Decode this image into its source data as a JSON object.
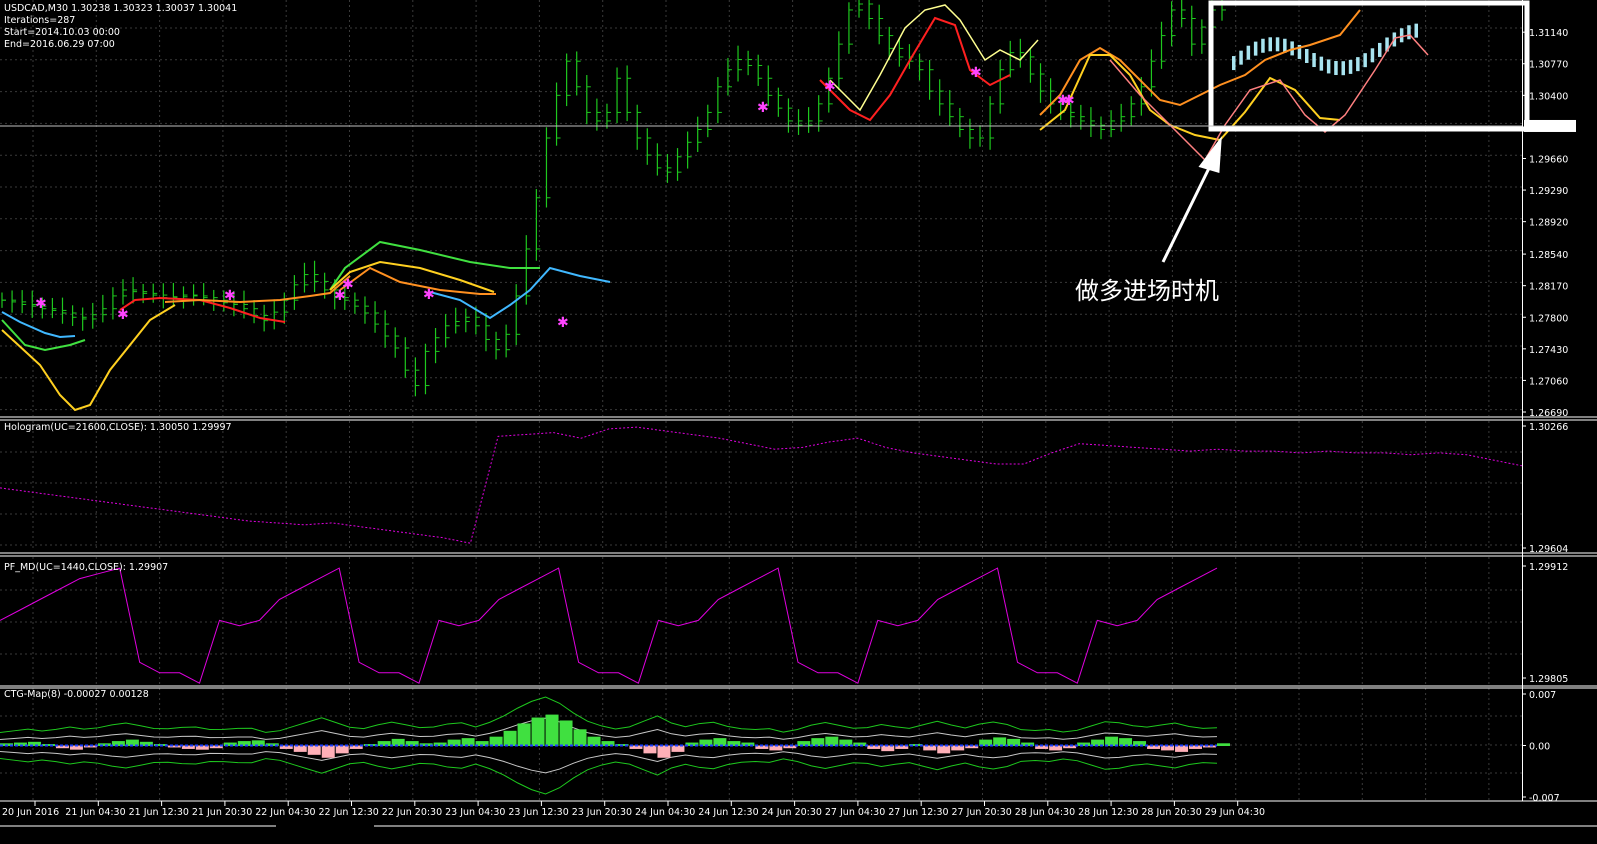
{
  "window": {
    "symbol_line": "USDCAD,M30  1.30238 1.30323 1.30037 1.30041",
    "iterations": "Iterations=287",
    "start": "Start=2014.10.03 00:00",
    "end": "End=2016.06.29 07:00"
  },
  "annotation": {
    "text": "做多进场时机"
  },
  "colors": {
    "background": "#000000",
    "grid": "#3a3a3a",
    "candle": "#1ec81e",
    "magenta": "#e000e0",
    "star": "#ff44ff",
    "highlight_box": "#ffffff",
    "sky": "#40b8ff",
    "cyan": "#a8e4f0",
    "pink": "#ffb0b8",
    "salmon": "#ff8080",
    "red": "#ff2020",
    "orange": "#ff9020",
    "yellow": "#ffd020",
    "lightyellow": "#ffff90",
    "green_line": "#40e040",
    "hist_green": "#40e040",
    "band": "#1ec81e"
  },
  "chart_data": [
    {
      "type": "line",
      "title": "USDCAD,M30  1.30238 1.30323 1.30037 1.30041",
      "ylim": [
        1.2669,
        1.3147
      ],
      "y_ticks": [
        "1.31140",
        "1.30770",
        "1.30400",
        "1.29660",
        "1.29290",
        "1.28920",
        "1.28540",
        "1.28170",
        "1.27800",
        "1.27430",
        "1.27060",
        "1.26690"
      ],
      "current_price": "1.30041",
      "close_series": [
        1.28,
        1.2798,
        1.2795,
        1.2793,
        1.279,
        1.2788,
        1.2785,
        1.278,
        1.2778,
        1.2783,
        1.279,
        1.2805,
        1.2812,
        1.281,
        1.2808,
        1.2806,
        1.2803,
        1.2804,
        1.2806,
        1.2805,
        1.2803,
        1.28,
        1.2797,
        1.2795,
        1.279,
        1.2782,
        1.2776,
        1.2786,
        1.28,
        1.2818,
        1.283,
        1.2822,
        1.2812,
        1.2803,
        1.28,
        1.2793,
        1.2785,
        1.2772,
        1.2758,
        1.2744,
        1.2718,
        1.27,
        1.274,
        1.2756,
        1.277,
        1.2775,
        1.278,
        1.277,
        1.2754,
        1.2742,
        1.276,
        1.2805,
        1.286,
        1.292,
        1.299,
        1.304,
        1.308,
        1.305,
        1.302,
        1.301,
        1.302,
        1.306,
        1.302,
        1.299,
        1.297,
        1.2955,
        1.295,
        1.2968,
        1.2985,
        1.3,
        1.302,
        1.305,
        1.307,
        1.3082,
        1.3075,
        1.306,
        1.304,
        1.3025,
        1.301,
        1.3005,
        1.301,
        1.303,
        1.306,
        1.31,
        1.314,
        1.3147,
        1.313,
        1.311,
        1.3095,
        1.3085,
        1.308,
        1.307,
        1.3045,
        1.303,
        1.3015,
        1.3,
        1.299,
        1.299,
        1.303,
        1.307,
        1.309,
        1.3085,
        1.3065,
        1.3045,
        1.303,
        1.302,
        1.3015,
        1.301,
        1.3005,
        1.3,
        1.301,
        1.3015,
        1.303,
        1.305,
        1.308,
        1.311,
        1.314,
        1.313,
        1.31,
        1.312,
        1.314,
        1.3147
      ]
    },
    {
      "type": "line",
      "title": "Hologram(UC=21600,CLOSE): 1.30050 1.29997",
      "ylim": [
        1.29604,
        1.30266
      ],
      "y_ticks": [
        "1.30266",
        "1.29604"
      ],
      "series": [
        {
          "values": [
            1.2993,
            1.2991,
            1.2989,
            1.2987,
            1.2985,
            1.2983,
            1.2981,
            1.2979,
            1.2977,
            1.2975,
            1.2974,
            1.2973,
            1.2974,
            1.2972,
            1.297,
            1.2968,
            1.2966,
            1.2963,
            1.3021,
            1.3022,
            1.3023,
            1.302,
            1.3025,
            1.3026,
            1.3024,
            1.3022,
            1.302,
            1.3017,
            1.3014,
            1.3015,
            1.3018,
            1.302,
            1.3015,
            1.3012,
            1.301,
            1.3008,
            1.3006,
            1.3006,
            1.3012,
            1.3017,
            1.3016,
            1.3015,
            1.3014,
            1.3013,
            1.3014,
            1.3013,
            1.3013,
            1.3012,
            1.3013,
            1.3012,
            1.3012,
            1.3011,
            1.3012,
            1.3011,
            1.3008,
            1.3005
          ]
        }
      ]
    },
    {
      "type": "line",
      "title": "PF_MD(UC=1440,CLOSE): 1.29907",
      "ylim": [
        1.29805,
        1.29912
      ],
      "y_ticks": [
        "1.29912",
        "1.29805"
      ],
      "series": [
        {
          "values": [
            1.2986,
            1.2987,
            1.2988,
            1.2989,
            1.299,
            1.29905,
            1.2991,
            1.2982,
            1.2981,
            1.2981,
            1.298,
            1.2986,
            1.29855,
            1.2986,
            1.2988,
            1.2989,
            1.299,
            1.2991,
            1.2982,
            1.2981,
            1.2981,
            1.298,
            1.2986,
            1.29855,
            1.2986,
            1.2988,
            1.2989,
            1.299,
            1.2991,
            1.2982,
            1.2981,
            1.2981,
            1.298,
            1.2986,
            1.29855,
            1.2986,
            1.2988,
            1.2989,
            1.299,
            1.2991,
            1.2982,
            1.2981,
            1.2981,
            1.298,
            1.2986,
            1.29855,
            1.2986,
            1.2988,
            1.2989,
            1.299,
            1.2991,
            1.2982,
            1.2981,
            1.2981,
            1.298,
            1.2986,
            1.29855,
            1.2986,
            1.2988,
            1.2989,
            1.299,
            1.2991
          ]
        }
      ]
    },
    {
      "type": "bar",
      "title": "CTG-Map(8) -0.00027 0.00128",
      "ylim": [
        -0.007,
        0.007
      ],
      "y_ticks": [
        "0.007",
        "0.00",
        "-0.007"
      ],
      "series": [
        {
          "values": [
            0.0003,
            0.0004,
            0.0005,
            0.0002,
            -0.0003,
            -0.0005,
            -0.0002,
            0.0003,
            0.0006,
            0.0008,
            0.0005,
            0.0002,
            -0.0002,
            -0.0004,
            -0.0005,
            -0.0003,
            0.0004,
            0.0006,
            0.0007,
            0.0003,
            -0.0004,
            -0.0008,
            -0.0012,
            -0.0016,
            -0.001,
            -0.0004,
            0.0002,
            0.0006,
            0.0009,
            0.0006,
            0.0003,
            0.0004,
            0.0008,
            0.001,
            0.0006,
            0.0012,
            0.002,
            0.003,
            0.0038,
            0.0042,
            0.0034,
            0.0022,
            0.0012,
            0.0006,
            0.0002,
            -0.0004,
            -0.001,
            -0.0016,
            -0.0008,
            0.0004,
            0.0008,
            0.001,
            0.0006,
            0.0004,
            -0.0004,
            -0.0006,
            -0.0003,
            0.0006,
            0.001,
            0.0012,
            0.0008,
            0.0004,
            -0.0004,
            -0.0007,
            -0.0004,
            0.0002,
            -0.0006,
            -0.001,
            -0.0006,
            -0.0003,
            0.0008,
            0.0011,
            0.0009,
            0.0004,
            -0.0004,
            -0.0006,
            -0.0003,
            0.0004,
            0.0008,
            0.0012,
            0.001,
            0.0006,
            -0.0004,
            -0.0006,
            -0.0008,
            -0.0004,
            -0.0002,
            0.0003
          ]
        }
      ]
    }
  ],
  "x_axis": {
    "labels": [
      "20 Jun 2016",
      "21 Jun 04:30",
      "21 Jun 12:30",
      "21 Jun 20:30",
      "22 Jun 04:30",
      "22 Jun 12:30",
      "22 Jun 20:30",
      "23 Jun 04:30",
      "23 Jun 12:30",
      "23 Jun 20:30",
      "24 Jun 04:30",
      "24 Jun 12:30",
      "24 Jun 20:30",
      "27 Jun 04:30",
      "27 Jun 12:30",
      "27 Jun 20:30",
      "28 Jun 04:30",
      "28 Jun 12:30",
      "28 Jun 20:30",
      "29 Jun 04:30"
    ]
  }
}
